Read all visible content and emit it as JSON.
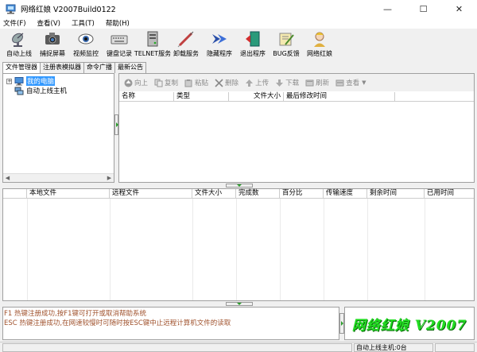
{
  "window": {
    "title": "网络红娘 V2007Build0122",
    "minimize": "—",
    "maximize": "☐",
    "close": "✕"
  },
  "menu": [
    "文件(F)",
    "查看(V)",
    "工具(T)",
    "帮助(H)"
  ],
  "toolbar": [
    {
      "label": "自动上线",
      "icon": "satellite-dish-icon"
    },
    {
      "label": "捕捉屏幕",
      "icon": "camera-icon"
    },
    {
      "label": "视频监控",
      "icon": "eye-icon"
    },
    {
      "label": "键盘记录",
      "icon": "keyboard-icon"
    },
    {
      "label": "TELNET服务",
      "icon": "server-icon"
    },
    {
      "label": "卸载服务",
      "icon": "syringe-icon"
    },
    {
      "label": "隐藏程序",
      "icon": "arrow-icon"
    },
    {
      "label": "退出程序",
      "icon": "exit-door-icon"
    },
    {
      "label": "BUG反馈",
      "icon": "feedback-icon"
    },
    {
      "label": "网络红娘",
      "icon": "matchmaker-icon"
    }
  ],
  "tabs": [
    "文件管理器",
    "注册表模拟器",
    "命令广播",
    "最新公告"
  ],
  "tree": {
    "my_computer": "我的电脑",
    "auto_online": "自动上线主机"
  },
  "file_toolbar": [
    {
      "label": "向上",
      "icon": "up-icon"
    },
    {
      "label": "复制",
      "icon": "copy-icon"
    },
    {
      "label": "粘贴",
      "icon": "paste-icon"
    },
    {
      "label": "删除",
      "icon": "delete-icon"
    },
    {
      "label": "上传",
      "icon": "upload-icon"
    },
    {
      "label": "下载",
      "icon": "download-icon"
    },
    {
      "label": "刷新",
      "icon": "refresh-icon"
    },
    {
      "label": "查看",
      "icon": "view-icon"
    }
  ],
  "file_columns": [
    "名称",
    "类型",
    "文件大小",
    "最后修改时间"
  ],
  "transfer_columns": [
    "本地文件",
    "远程文件",
    "文件大小",
    "完成数",
    "百分比",
    "传输速度",
    "剩余时间",
    "已用时间"
  ],
  "log": [
    "F1 热键注册成功,按F1键可打开或取消帮助系统",
    "ESC 热键注册成功,在网速较慢时可随时按ESC键中止远程计算机文件的读取"
  ],
  "brand_text": "网络红娘 V2007",
  "status": {
    "online_hosts": "自动上线主机:0台"
  },
  "colors": {
    "log_text": "#a0522d",
    "brand_green": "#22dd22",
    "selection": "#3399ff"
  }
}
